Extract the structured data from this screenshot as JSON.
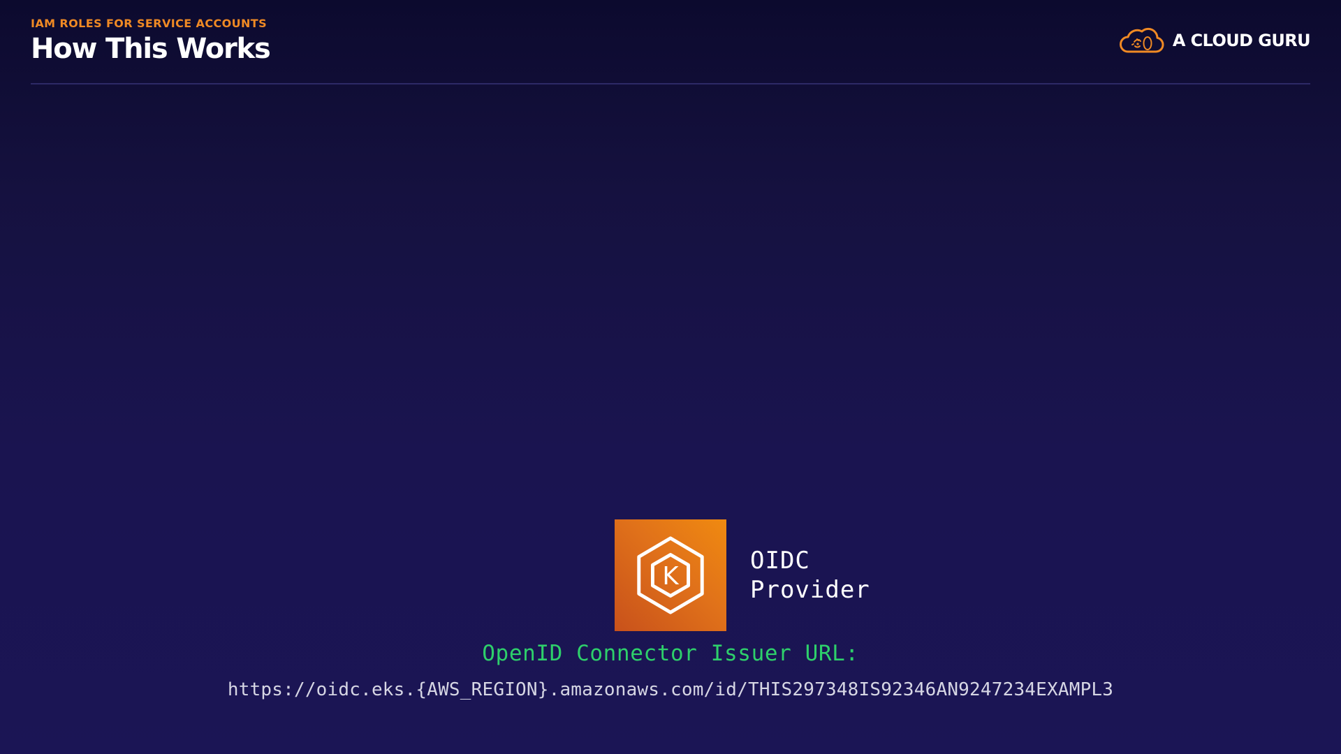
{
  "header": {
    "eyebrow": "IAM ROLES FOR SERVICE ACCOUNTS",
    "title": "How This Works"
  },
  "brand": {
    "name": "A CLOUD GURU",
    "logo_icon": "cloud-logo-icon",
    "accent_color": "#f08a24"
  },
  "diagram": {
    "provider": {
      "icon": "eks-kubernetes-icon",
      "label_line1": "OIDC",
      "label_line2": "Provider",
      "tile_color": "#e0711a"
    },
    "issuer": {
      "label": "OpenID Connector Issuer URL:",
      "label_color": "#2ed06b",
      "url": "https://oidc.eks.{AWS_REGION}.amazonaws.com/id/THIS297348IS92346AN9247234EXAMPL3"
    }
  }
}
